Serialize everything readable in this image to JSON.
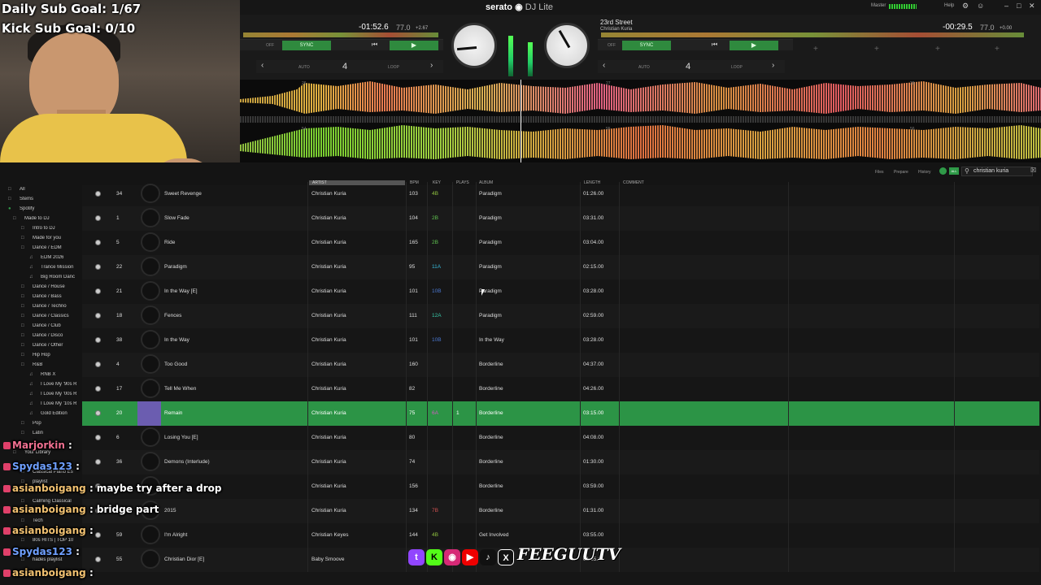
{
  "overlay": {
    "daily_goal": "Daily Sub Goal: 1/67",
    "kick_goal": "Kick Sub Goal: 0/10"
  },
  "app": {
    "brand": "serato",
    "product": "DJ Lite",
    "menu": [
      "Master",
      "Help"
    ]
  },
  "deck_left": {
    "time": "-01:52.6",
    "bpm": "77.0",
    "pitch": "+2.67",
    "sync_label": "SYNC",
    "off_label": "OFF",
    "auto_label": "AUTO",
    "loop_label": "LOOP",
    "loop_size": "4"
  },
  "deck_right": {
    "title": "23rd Street",
    "artist": "Christian Kuria",
    "time": "-00:29.5",
    "bpm": "77.0",
    "pitch": "+0.00",
    "sync_label": "SYNC",
    "off_label": "OFF",
    "auto_label": "AUTO",
    "loop_label": "LOOP",
    "loop_size": "4"
  },
  "library": {
    "tabs": [
      "Files",
      "Prepare",
      "History"
    ],
    "search_value": "christian kuria",
    "columns": [
      "ARTIST",
      "BPM",
      "KEY",
      "PLAYS",
      "ALBUM",
      "LENGTH",
      "COMMENT"
    ]
  },
  "sidebar": {
    "items": [
      "All",
      "Stems",
      "Spotify",
      "Made to DJ",
      "Intro to DJ",
      "Made for you",
      "Dance / EDM",
      "EDM 2026",
      "Trance Mission",
      "Big Room Danc",
      "Dance / House",
      "Dance / Bass",
      "Dance / Techno",
      "Dance / Classics",
      "Dance / Club",
      "Dance / Disco",
      "Dance / Other",
      "Hip Hop",
      "R&B",
      "RNB X",
      "I Love My '90s R",
      "I Love My '00s R",
      "I Love My '10s R",
      "Gold Edition",
      "Pop",
      "Latin",
      "Your Library",
      "Classical Piano Es",
      "playlist",
      "Calming Classical",
      "Tech",
      "80s HITS | TOP 10",
      "hades playlist"
    ]
  },
  "tracks": [
    {
      "num": "34",
      "title": "Sweet Revenge",
      "artist": "Christian Kuria",
      "bpm": "103",
      "key": "4B",
      "key_color": "#8fc23f",
      "plays": "",
      "album": "Paradigm",
      "length": "01:26.00"
    },
    {
      "num": "1",
      "title": "Slow Fade",
      "artist": "Christian Kuria",
      "bpm": "104",
      "key": "2B",
      "key_color": "#5fc24f",
      "plays": "",
      "album": "Paradigm",
      "length": "03:31.00"
    },
    {
      "num": "5",
      "title": "Ride",
      "artist": "Christian Kuria",
      "bpm": "165",
      "key": "2B",
      "key_color": "#5fc24f",
      "plays": "",
      "album": "Paradigm",
      "length": "03:04.00"
    },
    {
      "num": "22",
      "title": "Paradigm",
      "artist": "Christian Kuria",
      "bpm": "95",
      "key": "11A",
      "key_color": "#38b8d8",
      "plays": "",
      "album": "Paradigm",
      "length": "02:15.00"
    },
    {
      "num": "21",
      "title": "In the Way [E]",
      "artist": "Christian Kuria",
      "bpm": "101",
      "key": "10B",
      "key_color": "#4a78d0",
      "plays": "",
      "album": "Paradigm",
      "length": "03:28.00"
    },
    {
      "num": "18",
      "title": "Fences",
      "artist": "Christian Kuria",
      "bpm": "111",
      "key": "12A",
      "key_color": "#38c8a8",
      "plays": "",
      "album": "Paradigm",
      "length": "02:59.00"
    },
    {
      "num": "38",
      "title": "In the Way",
      "artist": "Christian Kuria",
      "bpm": "101",
      "key": "10B",
      "key_color": "#4a78d0",
      "plays": "",
      "album": "In the Way",
      "length": "03:28.00"
    },
    {
      "num": "4",
      "title": "Too Good",
      "artist": "Christian Kuria",
      "bpm": "160",
      "key": "",
      "key_color": "#888888",
      "plays": "",
      "album": "Borderline",
      "length": "04:37.00"
    },
    {
      "num": "17",
      "title": "Tell Me When",
      "artist": "Christian Kuria",
      "bpm": "82",
      "key": "",
      "key_color": "#888888",
      "plays": "",
      "album": "Borderline",
      "length": "04:26.00"
    },
    {
      "num": "20",
      "title": "Remain",
      "artist": "Christian Kuria",
      "bpm": "75",
      "key": "6A",
      "key_color": "#d05ac0",
      "plays": "1",
      "album": "Borderline",
      "length": "03:15.00"
    },
    {
      "num": "6",
      "title": "Losing You [E]",
      "artist": "Christian Kuria",
      "bpm": "80",
      "key": "",
      "key_color": "#888888",
      "plays": "",
      "album": "Borderline",
      "length": "04:08.00"
    },
    {
      "num": "36",
      "title": "Demons (Interlude)",
      "artist": "Christian Kuria",
      "bpm": "74",
      "key": "",
      "key_color": "#888888",
      "plays": "",
      "album": "Borderline",
      "length": "01:30.00"
    },
    {
      "num": "",
      "title": "",
      "artist": "Christian Kuria",
      "bpm": "156",
      "key": "",
      "key_color": "#888888",
      "plays": "",
      "album": "Borderline",
      "length": "03:59.00"
    },
    {
      "num": "",
      "title": "2015",
      "artist": "Christian Kuria",
      "bpm": "134",
      "key": "7B",
      "key_color": "#d05050",
      "plays": "",
      "album": "Borderline",
      "length": "01:31.00"
    },
    {
      "num": "59",
      "title": "I'm Alright",
      "artist": "Christian Keyes",
      "bpm": "144",
      "key": "4B",
      "key_color": "#8fc23f",
      "plays": "",
      "album": "Get Involved",
      "length": "03:55.00"
    },
    {
      "num": "55",
      "title": "Christian Dior [E]",
      "artist": "Baby Smoove",
      "bpm": "",
      "key": "",
      "key_color": "#888888",
      "plays": "",
      "album": "",
      "length": "01:55.00"
    }
  ],
  "chat": [
    {
      "user": "Marjorkin",
      "msg": ""
    },
    {
      "user": "Spydas123",
      "msg": ""
    },
    {
      "user": "asianboigang",
      "msg": "maybe try after a drop"
    },
    {
      "user": "asianboigang",
      "msg": "bridge part"
    },
    {
      "user": "asianboigang",
      "msg": ""
    },
    {
      "user": "Spydas123",
      "msg": ""
    },
    {
      "user": "asianboigang",
      "msg": ""
    }
  ],
  "socials": {
    "handle": "FEEGUUTV",
    "icons": [
      "twitch-icon",
      "kick-icon",
      "instagram-icon",
      "youtube-icon",
      "tiktok-icon",
      "x-icon"
    ]
  }
}
